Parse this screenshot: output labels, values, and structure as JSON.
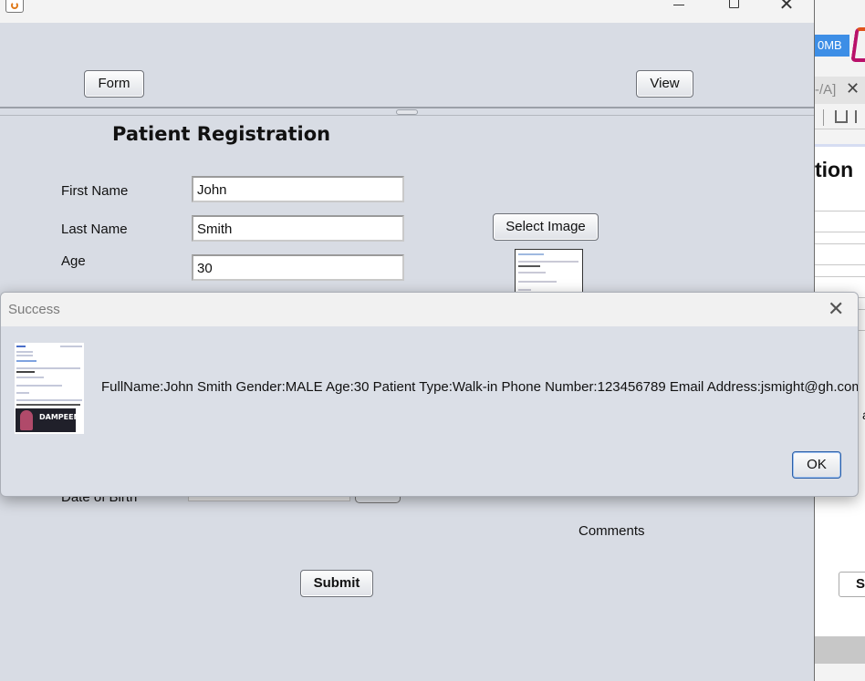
{
  "main_window": {
    "toolbar": {
      "form_label": "Form",
      "view_label": "View"
    },
    "form": {
      "title": "Patient Registration",
      "first_name_label": "First Name",
      "first_name_value": "John",
      "last_name_label": "Last Name",
      "last_name_value": "Smith",
      "age_label": "Age",
      "age_value": "30",
      "select_image_label": "Select Image",
      "dob_label": "Date of Birth",
      "comments_label": "Comments",
      "submit_label": "Submit"
    }
  },
  "dialog": {
    "title": "Success",
    "message": "FullName:John Smith Gender:MALE Age:30 Patient Type:Walk-in Phone Number:123456789 Email Address:jsmight@gh.com",
    "ok_label": "OK",
    "image_caption": "DAMPEEN"
  },
  "background_app": {
    "memory_label": "0MB",
    "tab_label": "-/A]",
    "heading_fragment": "tion",
    "side_letter": "a",
    "button_fragment": "S"
  },
  "colors": {
    "window_bg": "#d8dce4",
    "dialog_bg": "#dbdfe7",
    "ok_border": "#2b5fa8",
    "memory_badge": "#3d8ee6"
  }
}
